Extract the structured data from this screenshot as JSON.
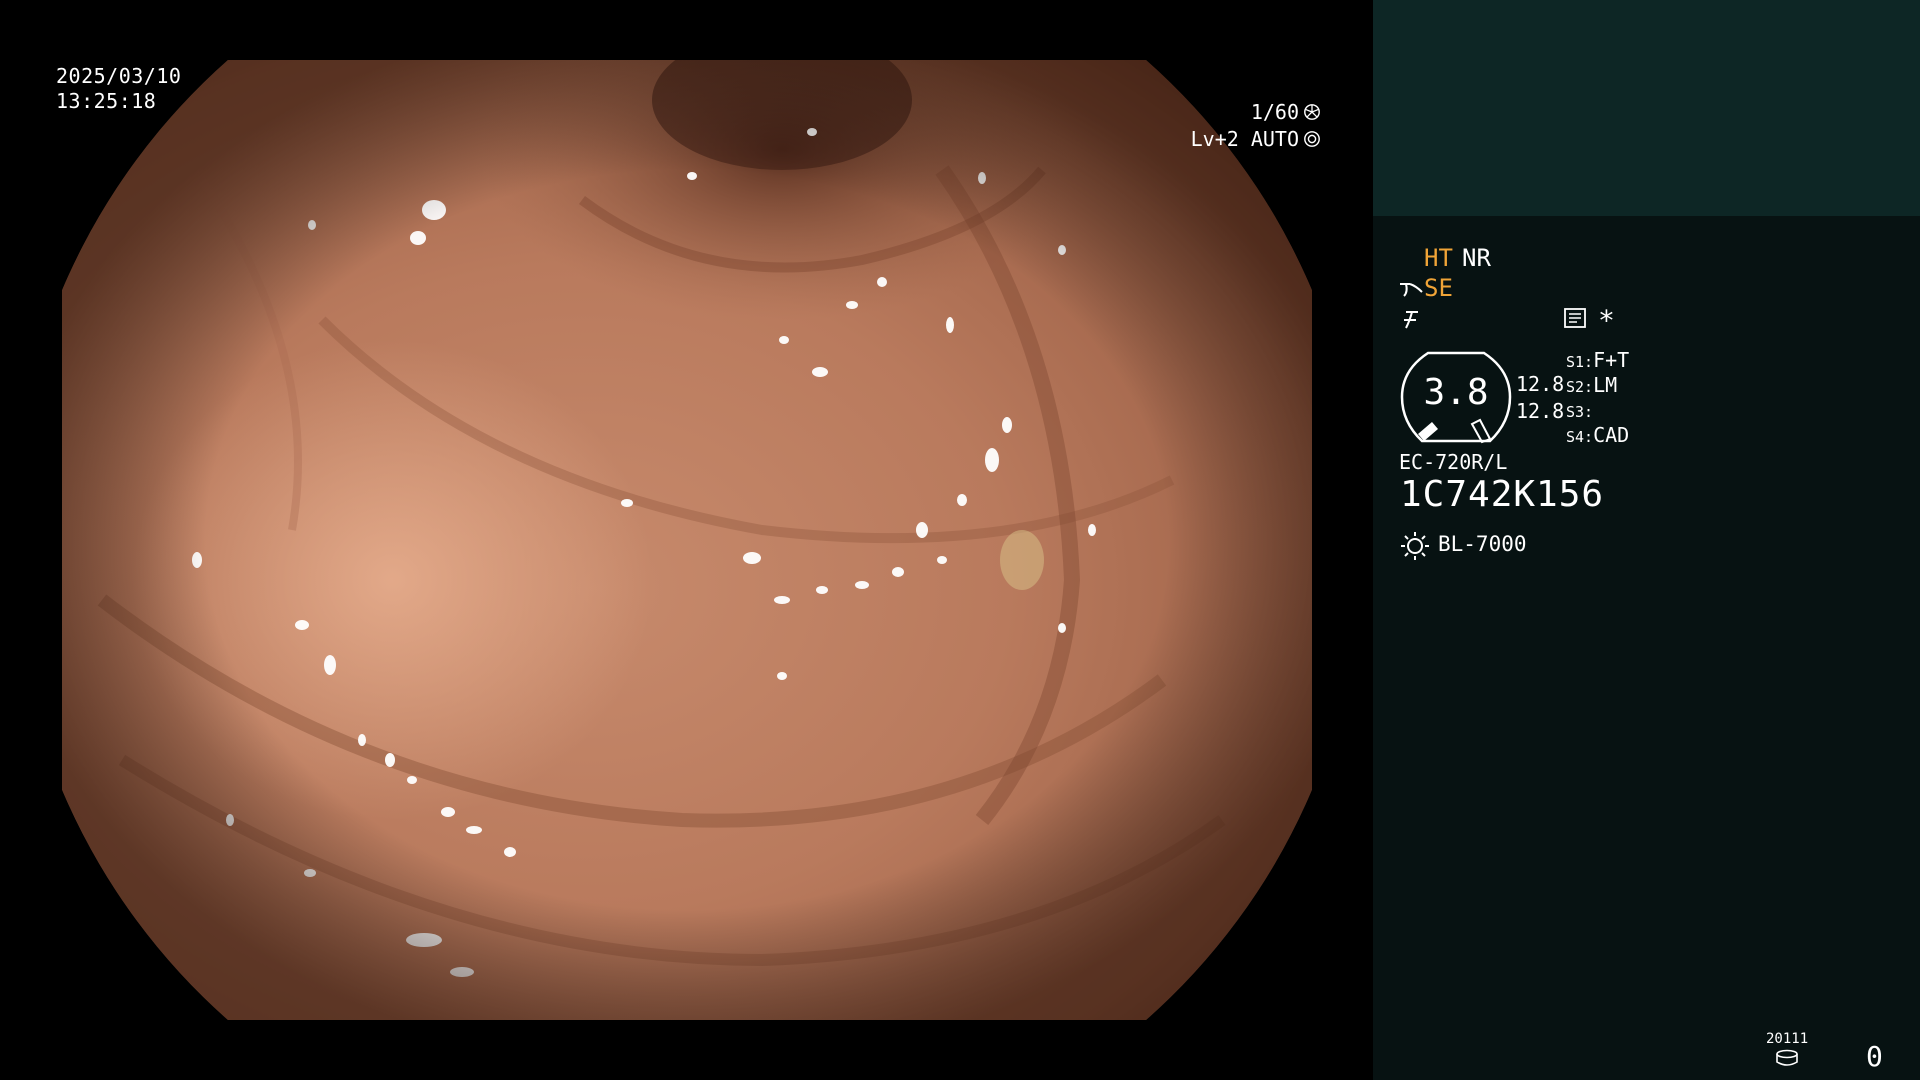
{
  "view": {
    "date": "2025/03/10",
    "time": "13:25:18",
    "shutter": "1/60",
    "level": "Lv+2 AUTO",
    "shutter_icon": "shutter-icon",
    "auto_icon": "auto-iris-icon"
  },
  "panel": {
    "ht": "HT",
    "nr": "NR",
    "se": "SE",
    "se_icon": "structure-enhance-icon",
    "enh_icon": "enhancement-icon",
    "memo_icon": "memo-icon",
    "asterisk": "*",
    "gauge_value": "3.8",
    "gauge_side_1": "12.8",
    "gauge_side_2": "12.8",
    "switches": [
      {
        "key": "S1:",
        "value": "F+T"
      },
      {
        "key": "S2:",
        "value": "LM"
      },
      {
        "key": "S3:",
        "value": ""
      },
      {
        "key": "S4:",
        "value": "CAD"
      }
    ],
    "scope_model": "EC-720R/L",
    "scope_serial": "1C742K156",
    "light_icon": "light-source-icon",
    "light_source": "BL-7000",
    "storage_number": "20111",
    "storage_icon": "storage-disk-icon",
    "counter": "0"
  },
  "colors": {
    "accent": "#f0a437",
    "panel_top": "#0d2625",
    "panel": "#071212",
    "tissue": "#c8886a"
  }
}
